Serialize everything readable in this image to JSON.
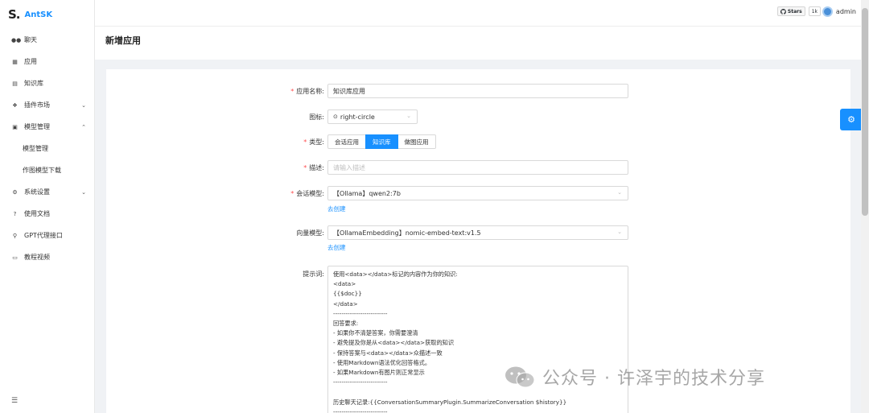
{
  "app": {
    "logo_mark": "S.",
    "name": "AntSK"
  },
  "sidebar": {
    "items": [
      {
        "label": "聊天",
        "icon": "chat-icon"
      },
      {
        "label": "应用",
        "icon": "app-icon"
      },
      {
        "label": "知识库",
        "icon": "book-icon"
      },
      {
        "label": "插件市场",
        "icon": "dropbox-icon",
        "caret": "chevron-down-icon"
      },
      {
        "label": "模型管理",
        "icon": "grid-icon",
        "caret": "chevron-up-icon"
      },
      {
        "label": "系统设置",
        "icon": "gear-icon",
        "caret": "chevron-down-icon"
      },
      {
        "label": "使用文档",
        "icon": "question-icon"
      },
      {
        "label": "GPT代理接口",
        "icon": "pin-icon"
      },
      {
        "label": "教程视频",
        "icon": "video-icon"
      }
    ],
    "sub_items": [
      "模型管理",
      "作图模型下载"
    ]
  },
  "header": {
    "github_label": "Stars",
    "github_count": "1k",
    "user": "admin"
  },
  "page": {
    "title": "新增应用"
  },
  "form": {
    "name_label": "应用名称:",
    "name_value": "知识库应用",
    "icon_label": "图标:",
    "icon_value": "right-circle",
    "type_label": "类型:",
    "type_options": [
      "会话应用",
      "知识库",
      "做图应用"
    ],
    "type_selected": "知识库",
    "desc_label": "描述:",
    "desc_placeholder": "请输入描述",
    "chat_model_label": "会话模型:",
    "chat_model_value": "【Ollama】qwen2:7b",
    "chat_model_create": "去创建",
    "embed_model_label": "向量模型:",
    "embed_model_value": "【OllamaEmbedding】nomic-embed-text:v1.5",
    "embed_model_create": "去创建",
    "prompt_label": "提示词:",
    "prompt_lines": [
      "使用<data></data>标记的内容作为你的知识:",
      "<data>",
      "{{$doc}}",
      "</data>",
      "--------------------------",
      "回答要求:",
      "- 如果你不清楚答案，你需要澄清",
      "- 避免提及你是从<data></data>获取的知识",
      "- 保持答案与<data></data>众描述一致",
      "- 使用Markdown语法优化回答格式。",
      "- 如果Markdown有图片则正常显示",
      "--------------------------",
      "",
      "历史聊天记录:{{ConversationSummaryPlugin.SummarizeConversation $history}}",
      "--------------------------"
    ]
  },
  "watermark": {
    "text": "公众号 · 许泽宇的技术分享"
  }
}
